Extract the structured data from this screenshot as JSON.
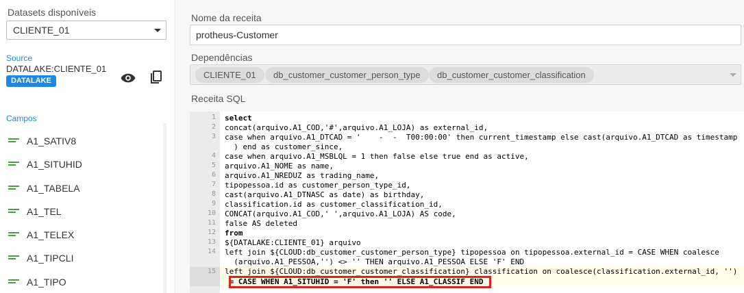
{
  "datasets": {
    "label": "Datasets disponíveis",
    "selected": "CLIENTE_01"
  },
  "source": {
    "label": "Source",
    "value": "DATALAKE:CLIENTE_01",
    "badge": "DATALAKE"
  },
  "campos": {
    "label": "Campos",
    "fields": [
      "A1_SATIV8",
      "A1_SITUHID",
      "A1_TABELA",
      "A1_TEL",
      "A1_TELEX",
      "A1_TIPCLI",
      "A1_TIPO"
    ]
  },
  "recipe": {
    "name_label": "Nome da receita",
    "name_value": "protheus-Customer",
    "deps_label": "Dependências",
    "deps": [
      "CLIENTE_01",
      "db_customer_customer_person_type",
      "db_customer_customer_classification"
    ],
    "sql_label": "Receita SQL"
  },
  "sql": {
    "line_numbers": [
      "1",
      "2",
      "3",
      "",
      "4",
      "5",
      "6",
      "7",
      "8",
      "9",
      "10",
      "11",
      "12",
      "13",
      "14",
      "",
      "15",
      ""
    ],
    "lines": [
      "select",
      "concat(arquivo.A1_COD,'#',arquivo.A1_LOJA) as external_id,",
      "case when arquivo.A1_DTCAD = '    -  -  T00:00:00' then current_timestamp else cast(arquivo.A1_DTCAD as timestamp",
      "  ) end as customer_since,",
      "case when arquivo.A1_MSBLQL = 1 then false else true end as active,",
      "arquivo.A1_NOME as name,",
      "arquivo.A1_NREDUZ as trading_name,",
      "tipopessoa.id as customer_person_type_id,",
      "cast(arquivo.A1_DTNASC as date) as birthday,",
      "classification.id as customer_classification_id,",
      "CONCAT(arquivo.A1_COD,' ',arquivo.A1_LOJA) AS code,",
      "false AS deleted",
      "from",
      "${DATALAKE:CLIENTE_01} arquivo",
      "left join ${CLOUD:db_customer_customer_person_type} tipopessoa on tipopessoa.external_id = CASE WHEN coalesce",
      "  (arquivo.A1_PESSOA,'') <> '' THEN arquivo.A1_PESSOA ELSE 'F' END",
      "left join ${CLOUD:db_customer_customer_classification} classification on coalesce(classification.external_id, '')",
      " = CASE WHEN A1_SITUHID = 'F' then '' ELSE A1_CLASSIF END"
    ]
  }
}
